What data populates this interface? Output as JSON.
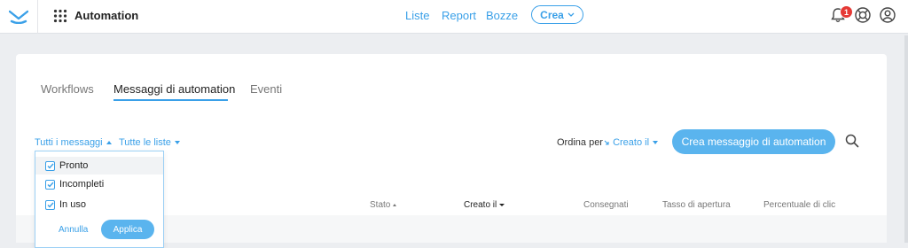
{
  "app": {
    "name": "Automation"
  },
  "nav": {
    "items": [
      "Liste",
      "Report",
      "Bozze"
    ],
    "crea_label": "Crea"
  },
  "notifications": {
    "count": "1"
  },
  "tabs": [
    {
      "label": "Workflows",
      "active": false
    },
    {
      "label": "Messaggi di automation",
      "active": true
    },
    {
      "label": "Eventi",
      "active": false
    }
  ],
  "filters": {
    "messages_filter": "Tutti i messaggi",
    "lists_filter": "Tutte le liste"
  },
  "sort": {
    "label": "Ordina per",
    "value": "Creato il"
  },
  "create_button": "Crea messaggio di automation",
  "dropdown": {
    "options": [
      {
        "label": "Pronto",
        "checked": true
      },
      {
        "label": "Incompleti",
        "checked": true
      },
      {
        "label": "In uso",
        "checked": true
      }
    ],
    "cancel": "Annulla",
    "apply": "Applica"
  },
  "table": {
    "columns": [
      "Stato",
      "Creato il",
      "Consegnati",
      "Tasso di apertura",
      "Percentuale di clic"
    ]
  },
  "colors": {
    "accent": "#3aa0e8",
    "button": "#5ab4ee",
    "badge": "#e53935"
  }
}
